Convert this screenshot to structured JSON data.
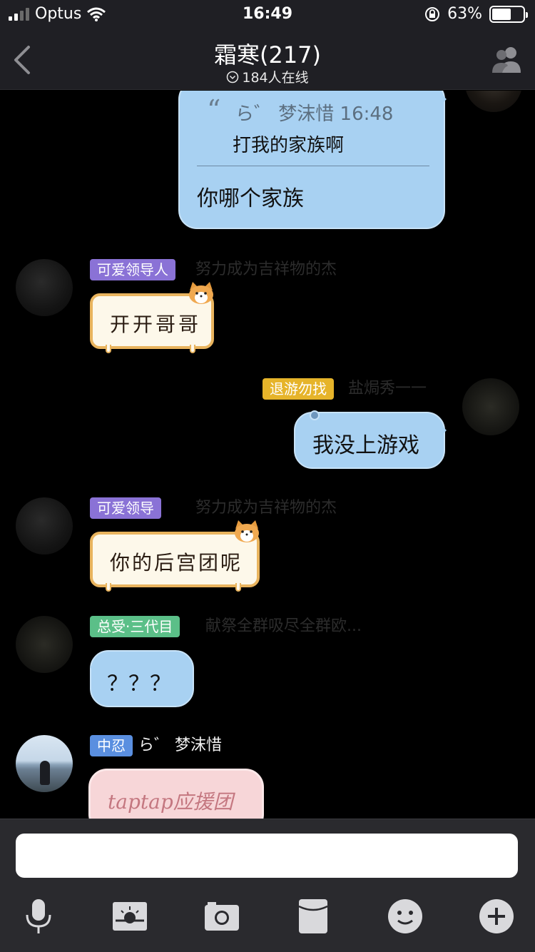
{
  "status_bar": {
    "carrier": "Optus",
    "time": "16:49",
    "battery_text": "63%",
    "battery_level": 0.63
  },
  "nav": {
    "title": "霜寒(217)",
    "online": "184人在线"
  },
  "messages": {
    "m1": {
      "quote_author": "ら゛ 梦沫惜 16:48",
      "quote_text": "打我的家族啊",
      "text": "你哪个家族"
    },
    "m2": {
      "badge": "可爱领导人",
      "nick": "努力成为吉祥物的杰",
      "text": "开开哥哥"
    },
    "m3": {
      "badge": "退游勿找",
      "nick": "盐焗秀一一",
      "text": "我没上游戏"
    },
    "m4": {
      "badge": "可爱领导",
      "nick": "努力成为吉祥物的杰",
      "text": "你的后宫团呢"
    },
    "m5": {
      "badge": "总受·三代目",
      "nick": "献祭全群吸尽全群欧...",
      "text": "？？？"
    },
    "m6": {
      "badge": "中忍",
      "nick": "ら゛ 梦沫惜",
      "text": "taptap应援团"
    }
  },
  "input": {
    "placeholder": "",
    "value": ""
  },
  "toolbar": [
    "microphone-icon",
    "image-icon",
    "camera-icon",
    "red-packet-icon",
    "emoji-icon",
    "plus-icon"
  ],
  "colors": {
    "bubble_blue": "#a8d1f2",
    "nav_bg": "#1f1f24",
    "badge_purple": "#8a72d6",
    "badge_yellow": "#e6b42a",
    "badge_green": "#5bbf88",
    "badge_blue": "#5a8fe0"
  }
}
